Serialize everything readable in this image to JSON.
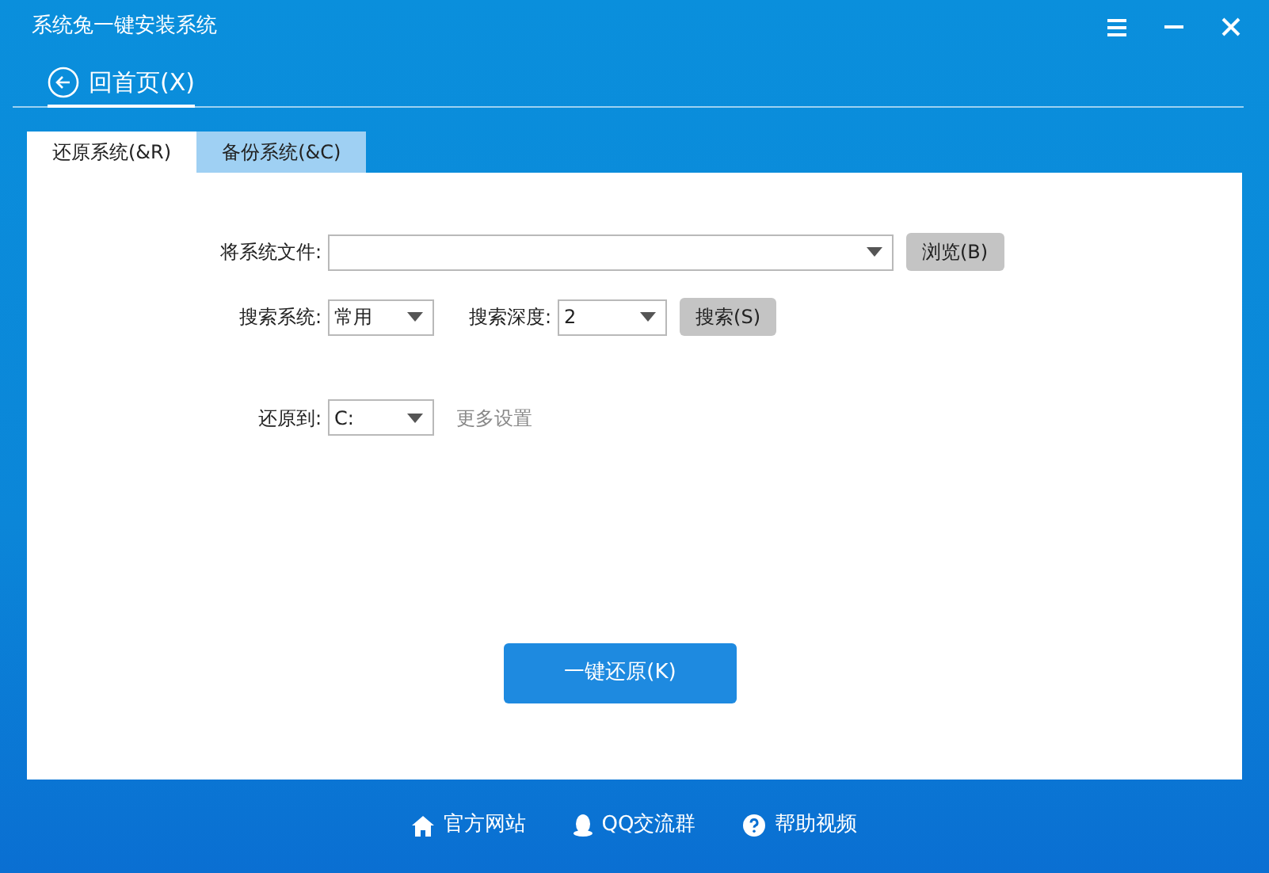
{
  "window": {
    "title": "系统兔一键安装系统"
  },
  "back": {
    "label": "回首页(X)"
  },
  "tabs": [
    {
      "label": "还原系统(&R)",
      "selected": true
    },
    {
      "label": "备份系统(&C)",
      "selected": false
    }
  ],
  "file_row": {
    "label": "将系统文件:",
    "button": "浏览(B)"
  },
  "search_row": {
    "system_label": "搜索系统:",
    "system_value": "常用",
    "depth_label": "搜索深度:",
    "depth_value": "2",
    "button": "搜索(S)"
  },
  "restore_row": {
    "label": "还原到:",
    "value": "C:",
    "more_link": "更多设置"
  },
  "primary_button": "一键还原(K)",
  "footer": [
    {
      "kind": "home",
      "label": "官方网站"
    },
    {
      "kind": "qq",
      "label": "QQ交流群"
    },
    {
      "kind": "help",
      "label": "帮助视频"
    }
  ]
}
